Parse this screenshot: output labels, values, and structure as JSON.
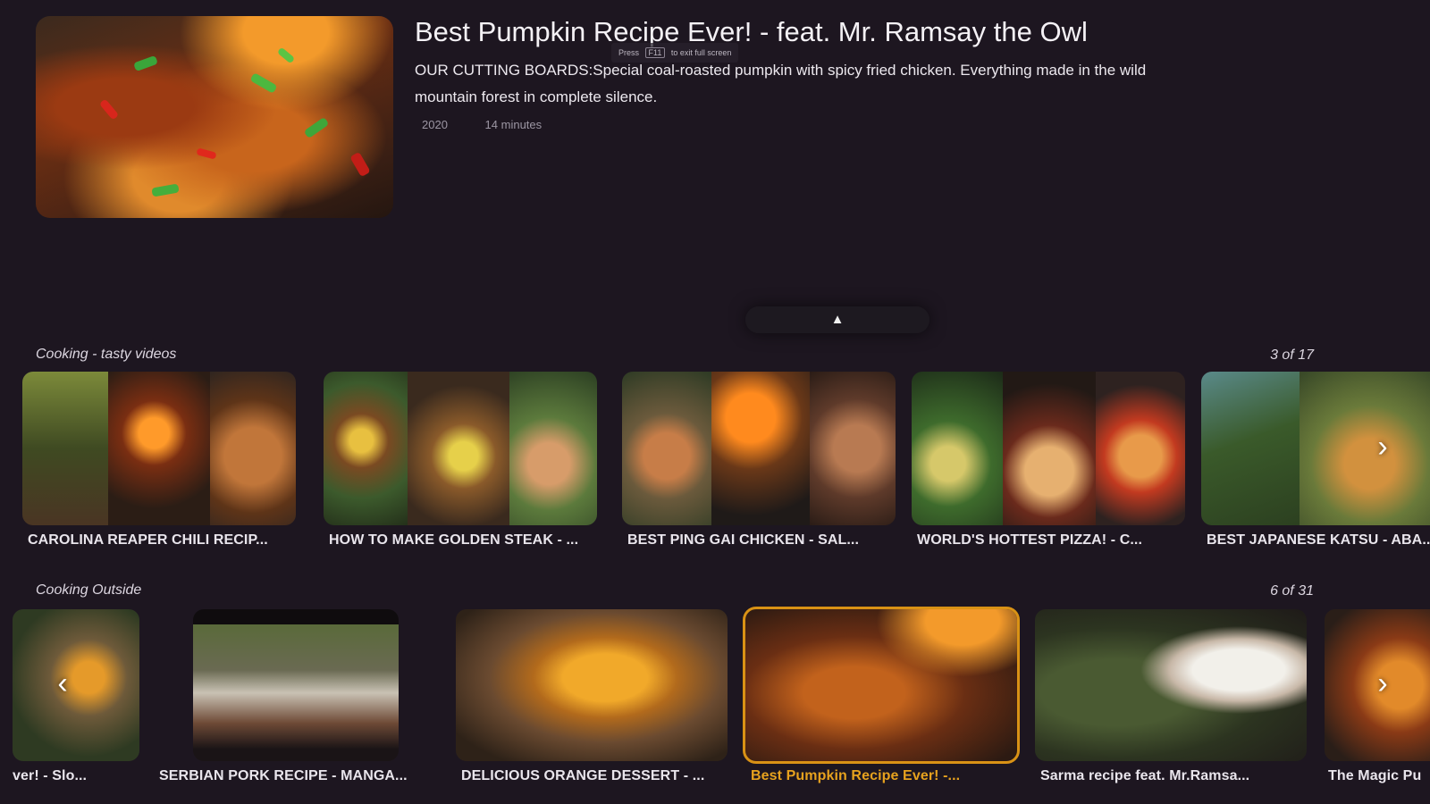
{
  "hero": {
    "title": "Best Pumpkin Recipe Ever! - feat. Mr. Ramsay the Owl",
    "description": "OUR CUTTING BOARDS:Special coal-roasted pumpkin with spicy fried chicken. Everything made in the wild mountain forest in complete silence.",
    "year": "2020",
    "duration": "14 minutes"
  },
  "fullscreen_hint": {
    "press": "Press",
    "key": "F11",
    "rest": "to exit full screen"
  },
  "collapse_icon": "▲",
  "rows": [
    {
      "title": "Cooking - tasty videos",
      "count": "3 of 17",
      "items": [
        {
          "label": "CAROLINA REAPER CHILI RECIP..."
        },
        {
          "label": "HOW TO MAKE GOLDEN STEAK - ..."
        },
        {
          "label": "BEST PING GAI CHICKEN - SAL..."
        },
        {
          "label": "WORLD'S HOTTEST PIZZA! - C..."
        },
        {
          "label": "BEST JAPANESE KATSU - ABA..."
        }
      ],
      "next_icon": "›"
    },
    {
      "title": "Cooking Outside",
      "count": "6 of 31",
      "items": [
        {
          "label": "ver! - Slo..."
        },
        {
          "label": "SERBIAN PORK RECIPE - MANGA..."
        },
        {
          "label": "DELICIOUS ORANGE DESSERT - ..."
        },
        {
          "label": "Best Pumpkin Recipe Ever! -...",
          "selected": true
        },
        {
          "label": "Sarma recipe feat. Mr.Ramsa..."
        },
        {
          "label": "The Magic Pu"
        }
      ],
      "prev_icon": "‹",
      "next_icon": "›"
    }
  ]
}
